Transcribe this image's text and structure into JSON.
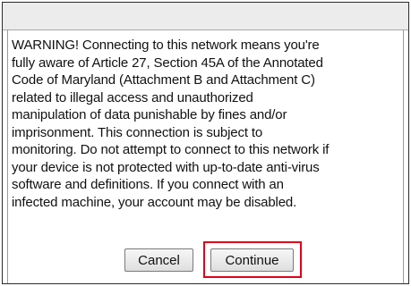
{
  "dialog": {
    "warning_lines": [
      "WARNING! Connecting to this network means you're",
      "fully aware of Article 27, Section 45A of the Annotated",
      "Code of Maryland (Attachment B and Attachment C)",
      "related to illegal access and unauthorized",
      "manipulation of data punishable by fines and/or",
      "imprisonment. This connection is subject to",
      "monitoring. Do not attempt to connect to this network if",
      "your device is not protected with up-to-date anti-virus",
      "software and definitions. If you connect with an",
      "infected machine, your account may be disabled."
    ],
    "cancel_label": "Cancel",
    "continue_label": "Continue"
  },
  "colors": {
    "highlight": "#e0001b",
    "titlebar": "#ececec",
    "border": "#2b2b2b"
  }
}
